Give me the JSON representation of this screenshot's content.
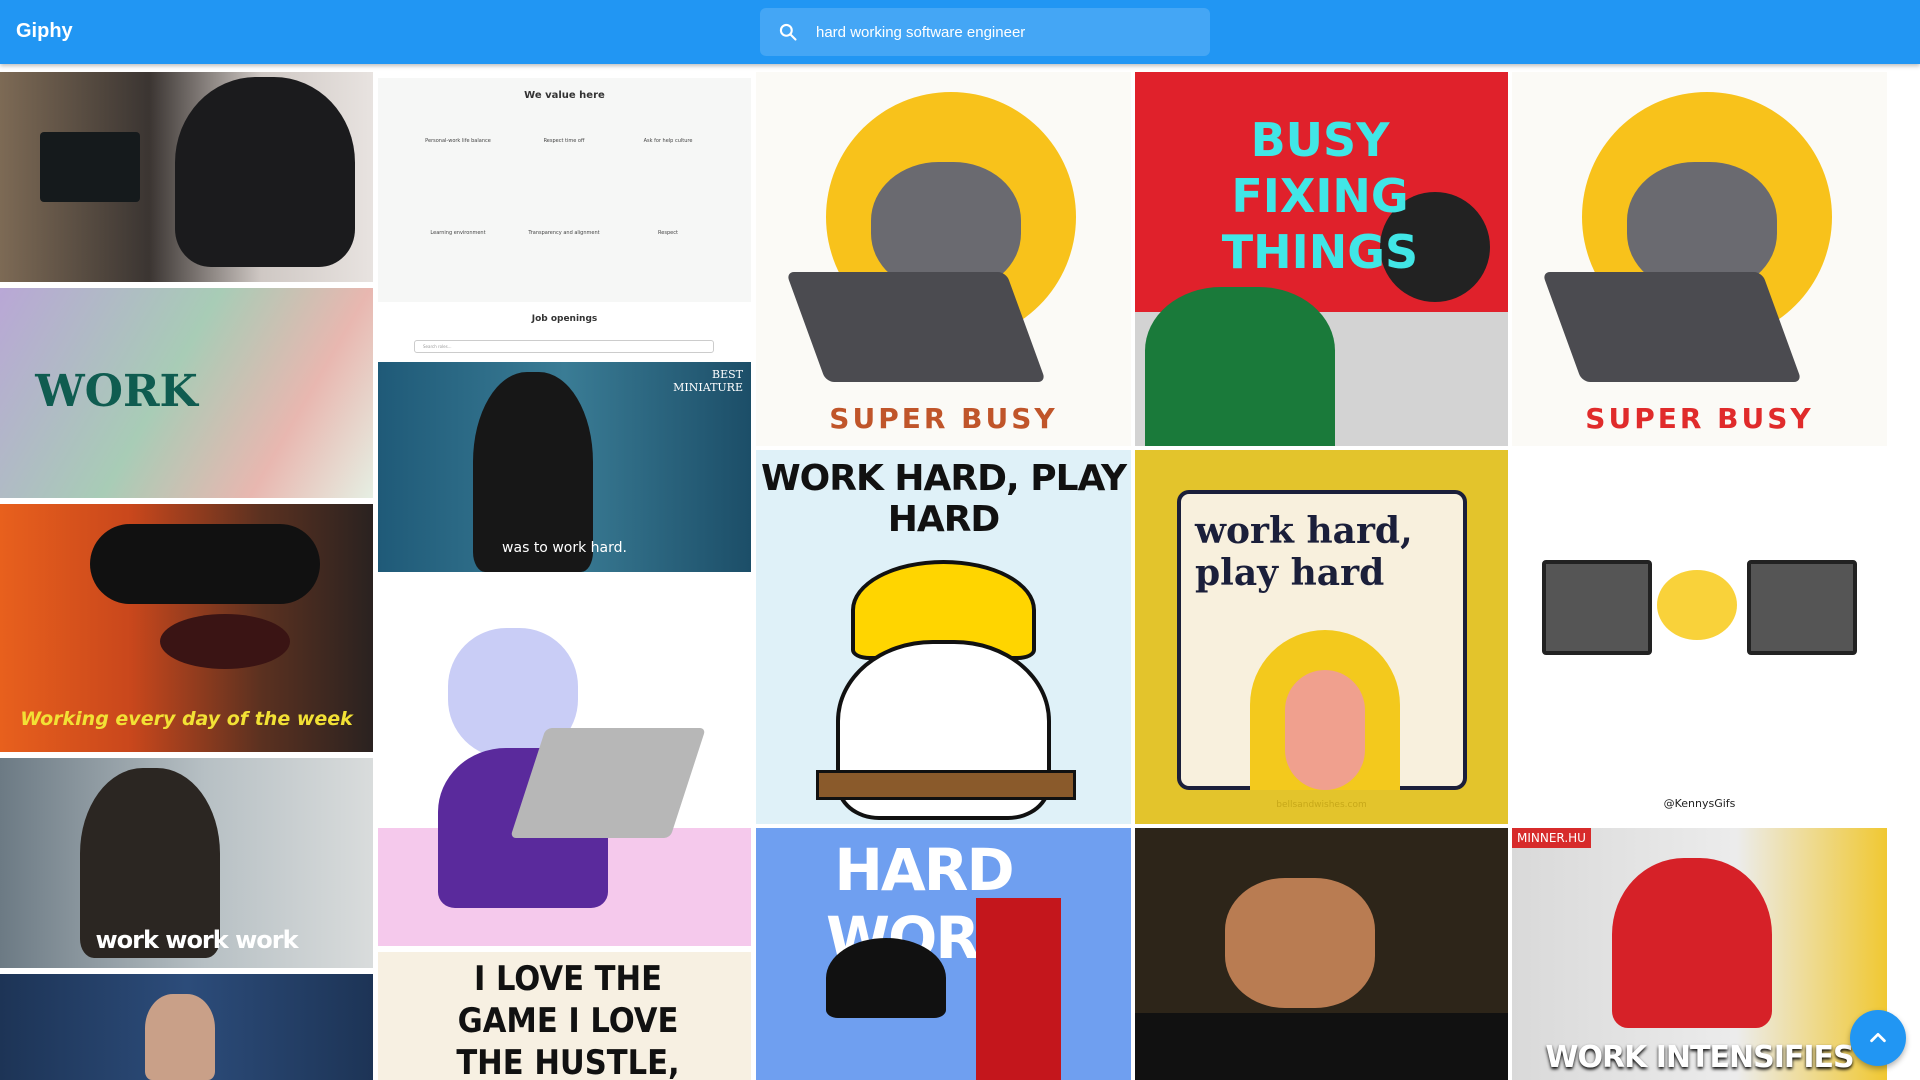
{
  "app": {
    "title": "Giphy"
  },
  "search": {
    "value": "hard working software engineer",
    "icon": "search-icon"
  },
  "tiles": {
    "t1": {
      "alt": "gorilla-typing-gif"
    },
    "t2": {
      "caption": "WORK"
    },
    "t3": {
      "caption": "Working every day of the week"
    },
    "t4": {
      "caption": "work work work"
    },
    "t5": {
      "alt": "talk-show-host-gif"
    },
    "t6": {
      "heading": "We value here",
      "values": [
        "Personal-work life balance",
        "Respect time off",
        "Ask for help culture",
        "Learning environment",
        "Transparency and alignment",
        "Respect"
      ],
      "jobs": "Job openings",
      "search_placeholder": "Search roles..."
    },
    "t7": {
      "caption": "was to work hard.",
      "logo": "BEST MINIATURE"
    },
    "t8": {
      "alt": "cat-at-laptop-gif"
    },
    "t9": {
      "caption": "I LOVE THE GAME I LOVE THE HUSTLE, MAN"
    },
    "t10": {
      "caption": "SUPER BUSY"
    },
    "t11": {
      "caption": "WORK HARD, PLAY HARD"
    },
    "t12": {
      "caption": "HARD WORK"
    },
    "t13": {
      "caption": "BUSY FIXING THINGS"
    },
    "t14": {
      "caption": "work hard, play hard",
      "watermark": "bellsandwishes.com"
    },
    "t15": {
      "alt": "typing-man-gif"
    },
    "t16": {
      "caption": "SUPER BUSY"
    },
    "t17": {
      "credit": "@KennysGifs"
    },
    "t18": {
      "caption": "WORK INTENSIFIES",
      "badge": "MINNER.HU"
    }
  },
  "fab": {
    "label": "^"
  }
}
